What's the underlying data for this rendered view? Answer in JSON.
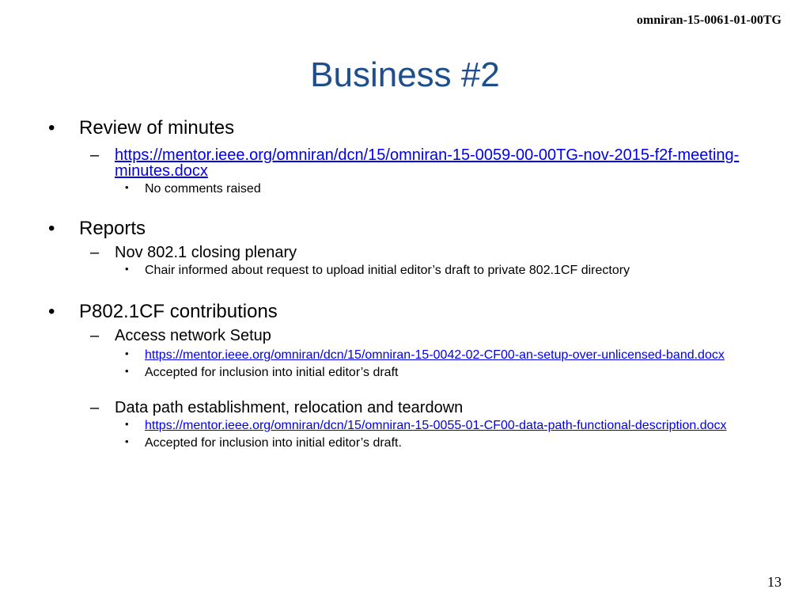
{
  "header": {
    "doc_id": "omniran-15-0061-01-00TG"
  },
  "title": "Business #2",
  "bullet_marker": "•",
  "sub_marker": "–",
  "sections": [
    {
      "heading": "Review of minutes",
      "items": [
        {
          "link": "https://mentor.ieee.org/omniran/dcn/15/omniran-15-0059-00-00TG-nov-2015-f2f-meeting-minutes.docx",
          "subitems": [
            "No comments raised"
          ]
        }
      ]
    },
    {
      "heading": "Reports",
      "items": [
        {
          "text": "Nov 802.1 closing plenary",
          "subitems": [
            "Chair informed about request to upload initial editor’s draft to private 802.1CF directory"
          ]
        }
      ]
    },
    {
      "heading": "P802.1CF contributions",
      "items": [
        {
          "text": "Access network Setup",
          "link_sub": "https://mentor.ieee.org/omniran/dcn/15/omniran-15-0042-02-CF00-an-setup-over-unlicensed-band.docx",
          "subitems": [
            "Accepted for inclusion into initial editor’s draft"
          ]
        },
        {
          "text": "Data path establishment, relocation and teardown",
          "link_sub": "https://mentor.ieee.org/omniran/dcn/15/omniran-15-0055-01-CF00-data-path-functional-description.docx",
          "subitems": [
            "Accepted for inclusion into initial editor’s draft."
          ]
        }
      ]
    }
  ],
  "page_number": "13"
}
